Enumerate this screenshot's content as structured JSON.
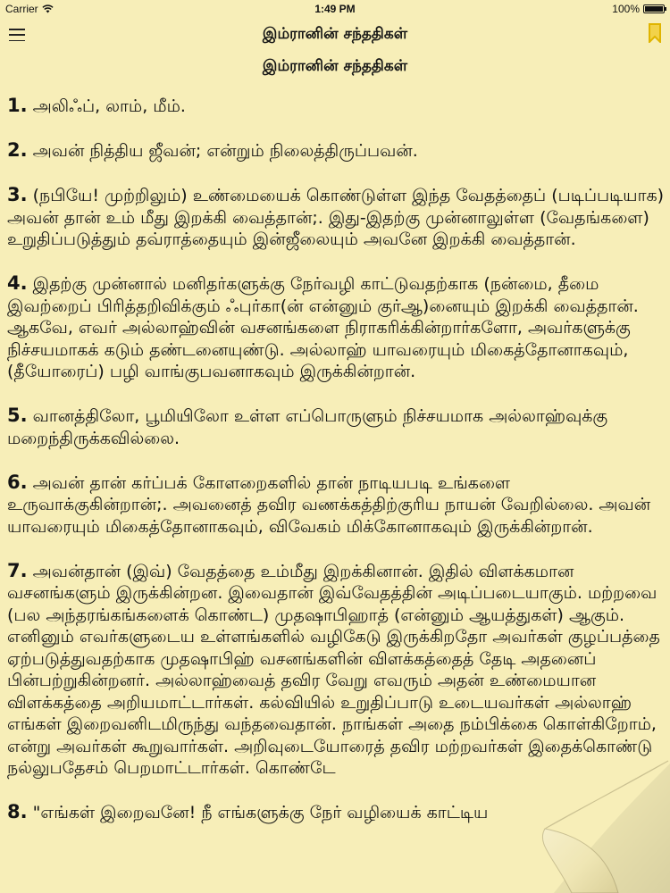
{
  "status_bar": {
    "carrier": "Carrier",
    "time": "1:49 PM",
    "battery": "100%",
    "battery_level": 1.0
  },
  "nav": {
    "title": "இம்ரானின் சந்ததிகள்",
    "menu_icon": "menu-icon",
    "bookmark_icon": "bookmark-icon",
    "accent_color": "#e0b400"
  },
  "page": {
    "heading": "இம்ரானின் சந்ததிகள்"
  },
  "verses": [
    {
      "num": "1.",
      "text": "அலிஃப், லாம், மீம்."
    },
    {
      "num": "2.",
      "text": "அவன் நித்திய ஜீவன்; என்றும் நிலைத்திருப்பவன்."
    },
    {
      "num": "3.",
      "text": "(நபியே! முற்றிலும்) உண்மையைக் கொண்டுள்ள இந்த வேதத்தைப் (படிப்படியாக) அவன் தான் உம் மீது இறக்கி வைத்தான்;. இது-இதற்கு முன்னாலுள்ள (வேதங்களை) உறுதிப்படுத்தும் தவ்ராத்தையும் இன்ஜீலையும் அவனே இறக்கி வைத்தான்."
    },
    {
      "num": "4.",
      "text": "இதற்கு முன்னால் மனிதர்களுக்கு நேர்வழி காட்டுவதற்காக (நன்மை, தீமை இவற்றைப் பிரித்தறிவிக்கும் ஃபுர்கா(ன் என்னும் குர்ஆ)னையும் இறக்கி வைத்தான். ஆகவே, எவர் அல்லாஹ்வின் வசனங்களை நிராகரிக்கின்றார்களோ, அவர்களுக்கு நிச்சயமாகக் கடும் தண்டனையுண்டு. அல்லாஹ் யாவரையும் மிகைத்தோனாகவும், (தீயோரைப்) பழி வாங்குபவனாகவும் இருக்கின்றான்."
    },
    {
      "num": "5.",
      "text": "வானத்திலோ, பூமியிலோ உள்ள எப்பொருளும் நிச்சயமாக அல்லாஹ்வுக்கு மறைந்திருக்கவில்லை."
    },
    {
      "num": "6.",
      "text": "அவன் தான் கர்ப்பக் கோளறைகளில் தான் நாடியபடி உங்களை உருவாக்குகின்றான்;. அவனைத் தவிர வணக்கத்திற்குரிய நாயன் வேறில்லை. அவன் யாவரையும் மிகைத்தோனாகவும், விவேகம் மிக்கோனாகவும் இருக்கின்றான்."
    },
    {
      "num": "7.",
      "text": "அவன்தான் (இவ்) வேதத்தை உம்மீது இறக்கினான். இதில் விளக்கமான வசனங்களும் இருக்கின்றன. இவைதான் இவ்வேதத்தின் அடிப்படையாகும். மற்றவை (பல அந்தரங்கங்களைக் கொண்ட) முதஷாபிஹாத் (என்னும் ஆயத்துகள்) ஆகும். எனினும் எவர்களுடைய உள்ளங்களில் வழிகேடு இருக்கிறதோ அவர்கள் குழப்பத்தை ஏற்படுத்துவதற்காக முதஷாபிஹ் வசனங்களின் விளக்கத்தைத் தேடி அதனைப் பின்பற்றுகின்றனர். அல்லாஹ்வைத் தவிர வேறு எவரும் அதன் உண்மையான விளக்கத்தை அறியமாட்டார்கள். கல்வியில் உறுதிப்பாடு உடையவர்கள் அல்லாஹ் எங்கள் இறைவனிடமிருந்து வந்தவைதான். நாங்கள் அதை நம்பிக்கை கொள்கிறோம், என்று அவர்கள் கூறுவார்கள். அறிவுடையோரைத் தவிர மற்றவர்கள் இதைக்கொண்டு நல்லுபதேசம் பெறமாட்டார்கள். கொண்டே"
    },
    {
      "num": "8.",
      "text": "\"எங்கள் இறைவனே! நீ எங்களுக்கு நேர் வழியைக் காட்டிய"
    }
  ]
}
